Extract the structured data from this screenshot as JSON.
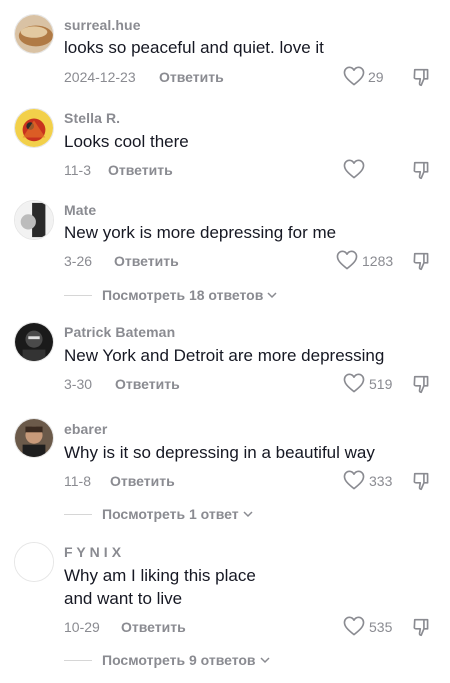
{
  "comments": [
    {
      "username": "surreal.hue",
      "text": "looks so peaceful and quiet. love it",
      "date": "2024-12-23",
      "reply_label": "Ответить",
      "likes": "29"
    },
    {
      "username": "Stella R.",
      "text": "Looks cool there",
      "date": "11-3",
      "reply_label": "Ответить",
      "likes": ""
    },
    {
      "username": "Mate",
      "text": "New york is more depressing for me",
      "date": "3-26",
      "reply_label": "Ответить",
      "likes": "1283",
      "view_replies": "Посмотреть 18 ответов"
    },
    {
      "username": "Patrick Bateman",
      "text": "New York and Detroit are more depressing",
      "date": "3-30",
      "reply_label": "Ответить",
      "likes": "519"
    },
    {
      "username": "ebarer",
      "text": "Why is it so depressing in a beautiful way",
      "date": "11-8",
      "reply_label": "Ответить",
      "likes": "333",
      "view_replies": "Посмотреть 1 ответ"
    },
    {
      "username": "F Y N I X",
      "text_lines": [
        "Why am I liking this place",
        "and want to live"
      ],
      "date": "10-29",
      "reply_label": "Ответить",
      "likes": "535",
      "view_replies": "Посмотреть 9 ответов"
    }
  ]
}
